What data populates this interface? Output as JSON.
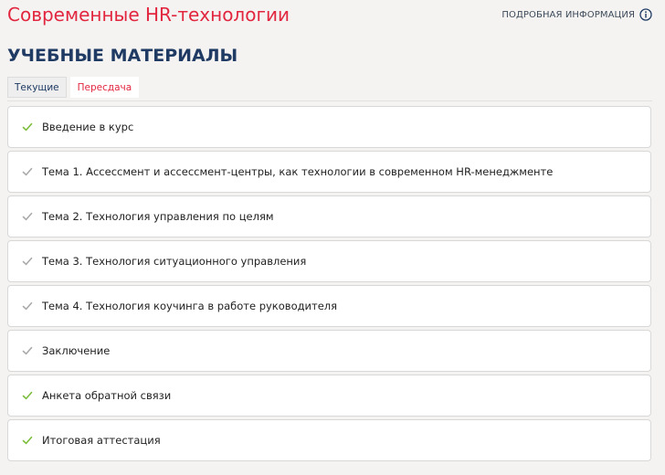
{
  "header": {
    "course_title": "Современные HR-технологии",
    "more_info_label": "ПОДРОБНАЯ ИНФОРМАЦИЯ",
    "info_icon": "info-circle-icon"
  },
  "section_title": "УЧЕБНЫЕ МАТЕРИАЛЫ",
  "tabs": [
    {
      "label": "Текущие",
      "active": true
    },
    {
      "label": "Пересдача",
      "active": false
    }
  ],
  "colors": {
    "accent_red": "#e2263f",
    "heading_blue": "#1f3a63",
    "check_green": "#7cbd3e",
    "check_gray": "#aaaaaa"
  },
  "materials": [
    {
      "label": "Введение в курс",
      "status": "complete",
      "icon": "check-icon"
    },
    {
      "label": "Тема 1. Ассессмент и ассессмент-центры, как технологии в современном HR-менеджменте",
      "status": "incomplete",
      "icon": "check-icon"
    },
    {
      "label": "Тема 2. Технология управления по целям",
      "status": "incomplete",
      "icon": "check-icon"
    },
    {
      "label": "Тема 3. Технология ситуационного управления",
      "status": "incomplete",
      "icon": "check-icon"
    },
    {
      "label": "Тема 4. Технология коучинга в работе руководителя",
      "status": "incomplete",
      "icon": "check-icon"
    },
    {
      "label": "Заключение",
      "status": "incomplete",
      "icon": "check-icon"
    },
    {
      "label": "Анкета обратной связи",
      "status": "complete",
      "icon": "check-icon"
    },
    {
      "label": "Итоговая аттестация",
      "status": "complete",
      "icon": "check-icon"
    }
  ]
}
